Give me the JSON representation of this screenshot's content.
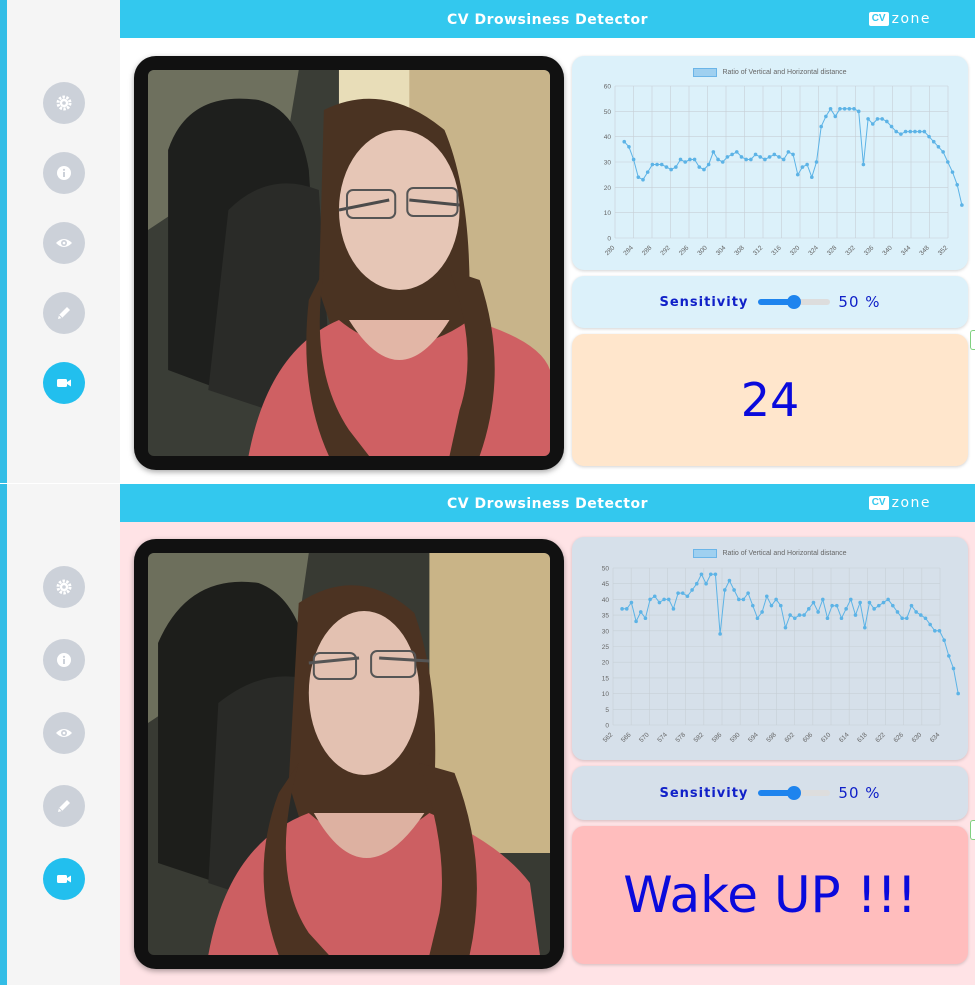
{
  "app": {
    "title": "CV Drowsiness Detector",
    "brand_cv": "CV",
    "brand_zone": "zone",
    "accent_color": "#33c8ee"
  },
  "sidebar": {
    "items": [
      {
        "name": "settings",
        "icon": "gear-icon"
      },
      {
        "name": "info",
        "icon": "info-icon"
      },
      {
        "name": "view",
        "icon": "eye-icon"
      },
      {
        "name": "edit",
        "icon": "pen-icon"
      },
      {
        "name": "camera",
        "icon": "video-camera-icon",
        "active": true
      }
    ]
  },
  "panels": [
    {
      "chart_data": {
        "type": "line",
        "legend": "Ratio of Vertical and Horizontal distance",
        "ylim": [
          0,
          60
        ],
        "yticks": [
          0,
          10,
          20,
          30,
          40,
          50,
          60
        ],
        "xticks": [
          "280",
          "284",
          "288",
          "292",
          "296",
          "300",
          "304",
          "308",
          "312",
          "316",
          "320",
          "324",
          "328",
          "332",
          "336",
          "340",
          "344",
          "348",
          "352"
        ],
        "x_start": 282,
        "x_end": 355,
        "series": [
          {
            "values": [
              38,
              36,
              31,
              24,
              23,
              26,
              29,
              29,
              29,
              28,
              27,
              28,
              31,
              30,
              31,
              31,
              28,
              27,
              29,
              34,
              31,
              30,
              32,
              33,
              34,
              32,
              31,
              31,
              33,
              32,
              31,
              32,
              33,
              32,
              31,
              34,
              33,
              25,
              28,
              29,
              24,
              30,
              44,
              48,
              51,
              48,
              51,
              51,
              51,
              51,
              50,
              29,
              47,
              45,
              47,
              47,
              46,
              44,
              42,
              41,
              42,
              42,
              42,
              42,
              42,
              40,
              38,
              36,
              34,
              30,
              26,
              21,
              13
            ]
          }
        ],
        "grid": true
      },
      "sensitivity": {
        "label": "Sensitivity",
        "value": 50,
        "value_text": "50 %"
      },
      "display": {
        "text": "24"
      }
    },
    {
      "chart_data": {
        "type": "line",
        "legend": "Ratio of Vertical and Horizontal distance",
        "ylim": [
          0,
          50
        ],
        "yticks": [
          0,
          5,
          10,
          15,
          20,
          25,
          30,
          35,
          40,
          45,
          50
        ],
        "xticks": [
          "562",
          "566",
          "570",
          "574",
          "578",
          "582",
          "586",
          "590",
          "594",
          "598",
          "602",
          "606",
          "610",
          "614",
          "618",
          "622",
          "626",
          "630",
          "634"
        ],
        "x_start": 564,
        "x_end": 638,
        "series": [
          {
            "values": [
              37,
              37,
              39,
              33,
              36,
              34,
              40,
              41,
              39,
              40,
              40,
              37,
              42,
              42,
              41,
              43,
              45,
              48,
              45,
              48,
              48,
              29,
              43,
              46,
              43,
              40,
              40,
              42,
              38,
              34,
              36,
              41,
              38,
              40,
              38,
              31,
              35,
              34,
              35,
              35,
              37,
              39,
              36,
              40,
              34,
              38,
              38,
              34,
              37,
              40,
              35,
              39,
              31,
              39,
              37,
              38,
              39,
              40,
              38,
              36,
              34,
              34,
              38,
              36,
              35,
              34,
              32,
              30,
              30,
              27,
              22,
              18,
              10
            ]
          }
        ],
        "grid": true
      },
      "sensitivity": {
        "label": "Sensitivity",
        "value": 50,
        "value_text": "50 %"
      },
      "display": {
        "text": "Wake UP !!!"
      }
    }
  ]
}
